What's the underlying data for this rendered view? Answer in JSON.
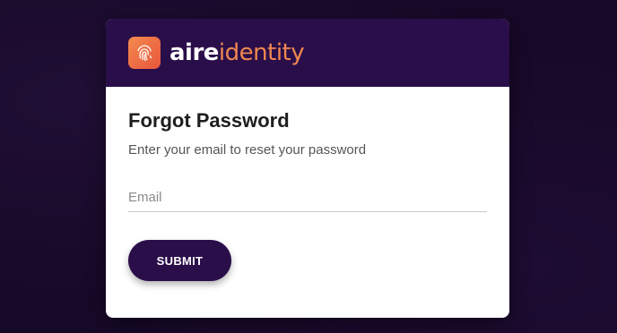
{
  "brand": {
    "logo_icon": "fingerprint-icon",
    "name_part1": "aire",
    "name_part2": "identity",
    "colors": {
      "header": "#2a0e4a",
      "accent": "#f0874f"
    }
  },
  "form": {
    "title": "Forgot Password",
    "subtitle": "Enter your email to reset your password",
    "email_placeholder": "Email",
    "email_value": "",
    "submit_label": "SUBMIT"
  }
}
